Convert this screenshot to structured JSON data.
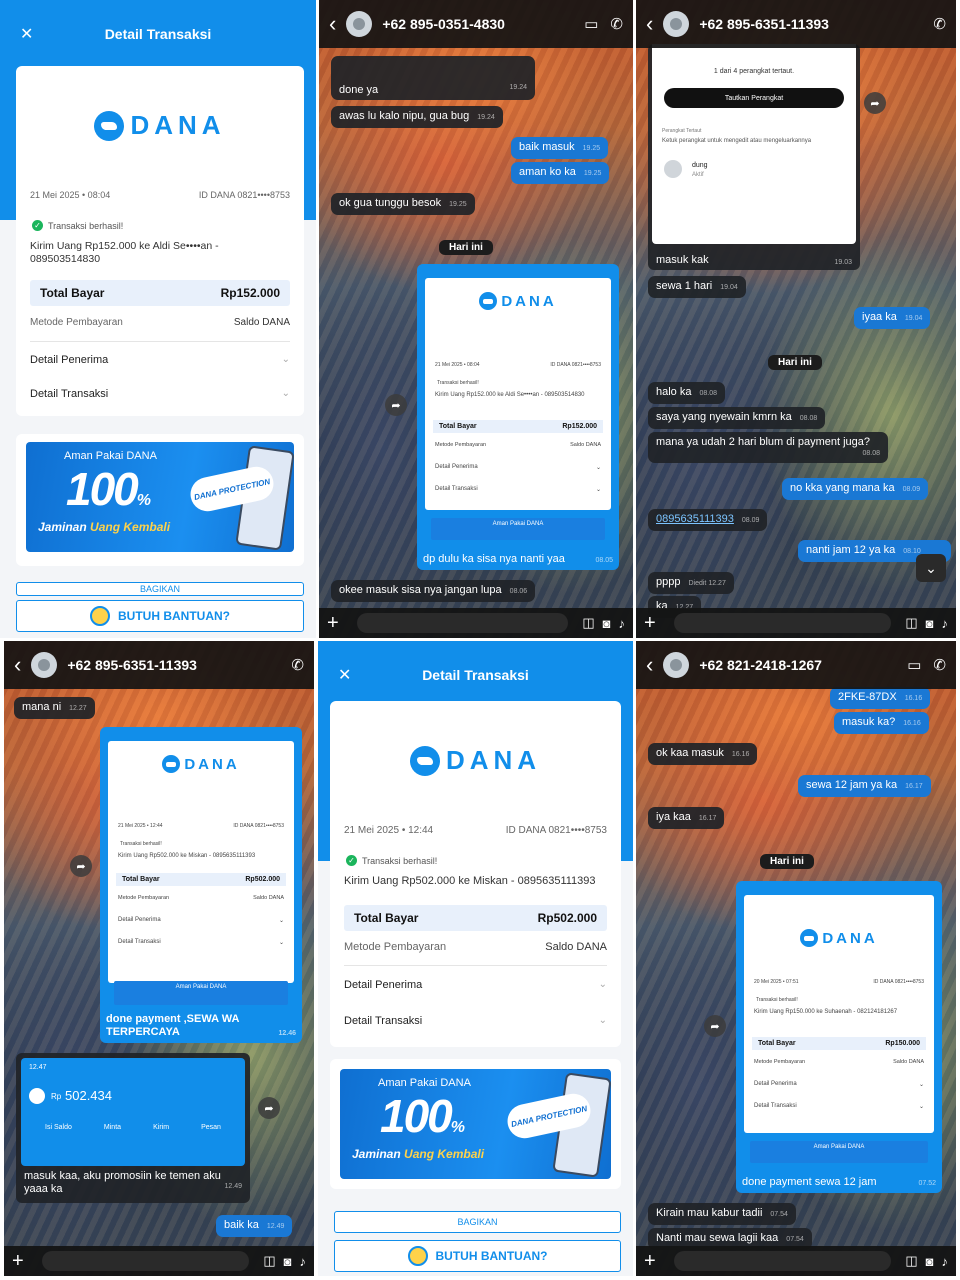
{
  "panel1": {
    "title": "Detail Transaksi",
    "date": "21 Mei 2025 • 08:04",
    "id_dana": "ID DANA 0821••••8753",
    "success": "Transaksi berhasil!",
    "desc": "Kirim Uang Rp152.000 ke Aldi Se••••an - 089503514830",
    "total_label": "Total Bayar",
    "total_value": "Rp152.000",
    "method_label": "Metode Pembayaran",
    "method_value": "Saldo DANA",
    "detail_penerima": "Detail Penerima",
    "detail_transaksi": "Detail Transaksi",
    "banner_top": "Aman Pakai DANA",
    "banner_100": "100",
    "banner_bottom_a": "Jaminan",
    "banner_bottom_b": "Uang Kembali",
    "banner_badge": "DANA PROTECTION",
    "bagikan": "BAGIKAN",
    "help": "BUTUH BANTUAN?"
  },
  "panel2": {
    "contact": "+62 895-0351-4830",
    "messages": [
      {
        "text": "done ya",
        "time": "19.24"
      },
      {
        "text": "awas lu kalo nipu, gua bug",
        "time": "19.24"
      },
      {
        "text": "baik masuk",
        "time": "19.25"
      },
      {
        "text": "aman ko ka",
        "time": "19.25"
      },
      {
        "text": "ok gua tunggu besok",
        "time": "19.25"
      },
      {
        "text": "dp dulu ka sisa nya nanti yaa",
        "time": "08.05"
      },
      {
        "text": "okee masuk sisa nya jangan lupa",
        "time": "08.06"
      }
    ],
    "day": "Hari ini",
    "mini_date": "21 Mei 2025 • 08:04",
    "mini_id": "ID DANA 0821••••8753",
    "mini_desc": "Kirim Uang Rp152.000 ke Aldi Se••••an - 089503514830",
    "mini_total": "Rp152.000"
  },
  "panel3": {
    "contact": "+62 895-6351-11393",
    "device_count": "1 dari 4 perangkat tertaut.",
    "link_button": "Tautkan Perangkat",
    "linked_label": "Perangkat Tertaut",
    "linked_hint": "Ketuk perangkat untuk mengedit atau mengeluarkannya",
    "device_name": "dung",
    "device_status": "Aktif",
    "messages": [
      {
        "text": "masuk kak",
        "time": "19.03"
      },
      {
        "text": "sewa 1 hari",
        "time": "19.04"
      },
      {
        "text": "iyaa ka",
        "time": "19.04"
      },
      {
        "text": "halo ka",
        "time": "08.08"
      },
      {
        "text": "saya yang nyewain kmrn ka",
        "time": "08.08"
      },
      {
        "text": "mana ya udah 2 hari blum di payment juga?",
        "time": "08.08"
      },
      {
        "text": "no kka yang mana ka",
        "time": "08.09"
      },
      {
        "text": "0895635111393",
        "time": "08.09"
      },
      {
        "text": "nanti jam 12 ya ka",
        "time": "08.10"
      },
      {
        "text": "pppp",
        "time": "Diedit 12.27"
      },
      {
        "text": "ka",
        "time": "12.27"
      }
    ],
    "day": "Hari ini"
  },
  "panel4": {
    "contact": "+62 895-6351-11393",
    "messages": [
      {
        "text": "mana ni",
        "time": "12.27"
      },
      {
        "text": "done payment ,SEWA WA TERPERCAYA",
        "time": "12.46"
      },
      {
        "text": "masuk kaa, aku promosiin ke temen aku yaaa ka",
        "time": "12.49"
      },
      {
        "text": "baik ka",
        "time": "12.49"
      }
    ],
    "mini_date": "21 Mei 2025 • 12:44",
    "mini_id": "ID DANA 0821••••8753",
    "mini_desc": "Kirim Uang Rp502.000 ke Miskan - 0895635111393",
    "mini_total": "Rp502.000",
    "balance_time": "12.47",
    "balance": "502.434",
    "balance_currency": "Rp",
    "actions": [
      "Isi Saldo",
      "Minta",
      "Kirim",
      "Pesan"
    ]
  },
  "panel5": {
    "title": "Detail Transaksi",
    "date": "21 Mei 2025 • 12:44",
    "id_dana": "ID DANA 0821••••8753",
    "success": "Transaksi berhasil!",
    "desc": "Kirim Uang Rp502.000 ke Miskan - 0895635111393",
    "total_label": "Total Bayar",
    "total_value": "Rp502.000",
    "method_label": "Metode Pembayaran",
    "method_value": "Saldo DANA",
    "detail_penerima": "Detail Penerima",
    "detail_transaksi": "Detail Transaksi",
    "banner_top": "Aman Pakai DANA",
    "banner_100": "100",
    "banner_bottom_a": "Jaminan",
    "banner_bottom_b": "Uang Kembali",
    "banner_badge": "DANA PROTECTION",
    "bagikan": "BAGIKAN",
    "help": "BUTUH BANTUAN?"
  },
  "panel6": {
    "contact": "+62 821-2418-1267",
    "messages": [
      {
        "text": "2FKE-87DX",
        "time": "16.16"
      },
      {
        "text": "masuk ka?",
        "time": "16.16"
      },
      {
        "text": "ok kaa masuk",
        "time": "16.16"
      },
      {
        "text": "sewa 12 jam ya ka",
        "time": "16.17"
      },
      {
        "text": "iya kaa",
        "time": "16.17"
      },
      {
        "text": "done payment sewa 12 jam",
        "time": "07.52"
      },
      {
        "text": "Kirain mau kabur tadii",
        "time": "07.54"
      },
      {
        "text": "Nanti mau sewa lagii kaa",
        "time": "07.54"
      }
    ],
    "day": "Hari ini",
    "mini_date": "20 Mei 2025 • 07:51",
    "mini_id": "ID DANA 0821••••8753",
    "mini_desc": "Kirim Uang Rp150.000 ke Suhaenah - 082124181267",
    "mini_total": "Rp150.000"
  },
  "common": {
    "dana_word": "DANA",
    "mini_success": "Transaksi berhasil!",
    "mini_total_label": "Total Bayar",
    "mini_method_label": "Metode Pembayaran",
    "mini_method_value": "Saldo DANA",
    "mini_banner": "Aman Pakai DANA"
  }
}
